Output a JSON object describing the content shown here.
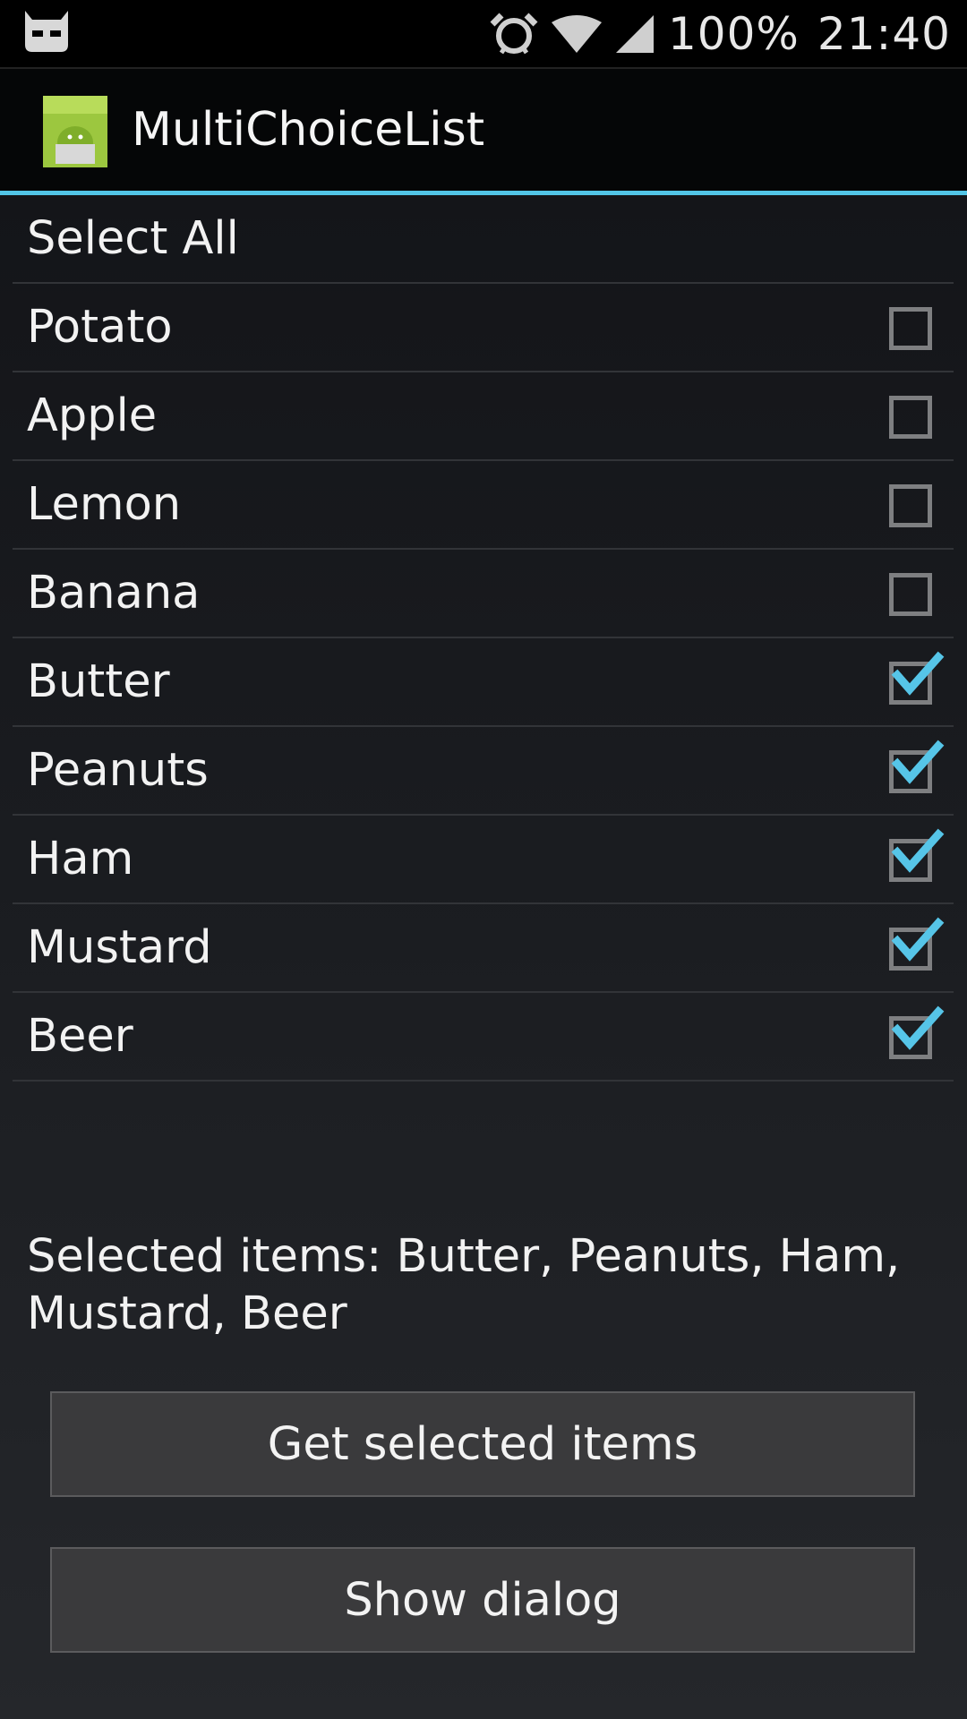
{
  "status_bar": {
    "battery": "100%",
    "time": "21:40",
    "icons": [
      "cyanogen-bot-icon",
      "alarm-icon",
      "wifi-icon",
      "signal-icon"
    ]
  },
  "action_bar": {
    "title": "MultiChoiceList",
    "icon": "android-app-icon",
    "accent_color": "#52c5e6"
  },
  "list": {
    "select_all_label": "Select All",
    "items": [
      {
        "label": "Potato",
        "checked": false
      },
      {
        "label": "Apple",
        "checked": false
      },
      {
        "label": "Lemon",
        "checked": false
      },
      {
        "label": "Banana",
        "checked": false
      },
      {
        "label": "Butter",
        "checked": true
      },
      {
        "label": "Peanuts",
        "checked": true
      },
      {
        "label": "Ham",
        "checked": true
      },
      {
        "label": "Mustard",
        "checked": true
      },
      {
        "label": "Beer",
        "checked": true
      }
    ]
  },
  "selected_text": "Selected items: Butter, Peanuts, Ham, Mustard, Beer",
  "buttons": {
    "get_selected": "Get selected items",
    "show_dialog": "Show dialog"
  }
}
